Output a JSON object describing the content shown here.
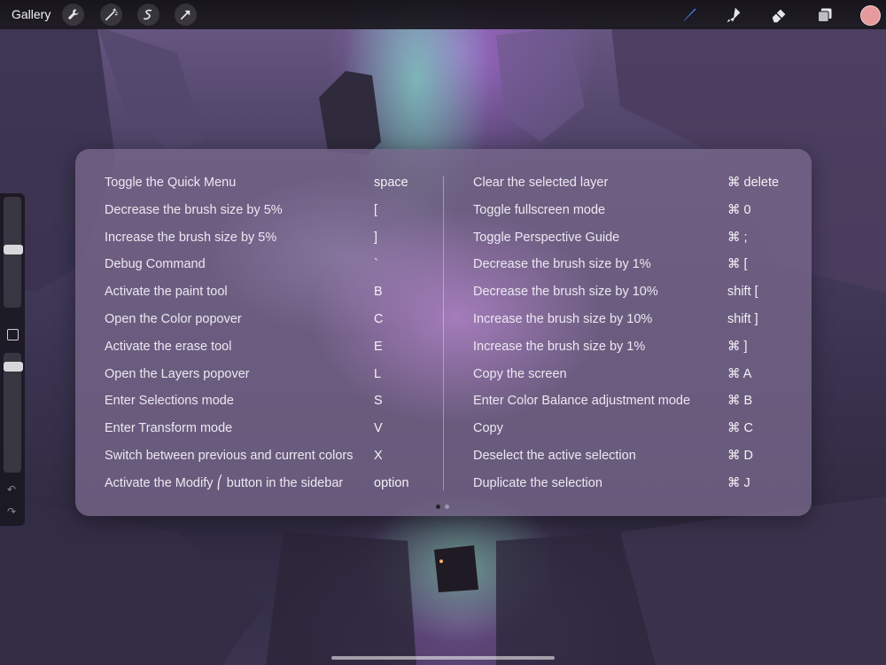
{
  "toolbar": {
    "gallery_label": "Gallery",
    "accent_color": "#4a8cff",
    "current_color": "#e59a9e",
    "left_icons": [
      "wrench-icon",
      "magic-wand-icon",
      "selection-icon",
      "transform-arrow-icon"
    ],
    "right_icons": [
      "brush-icon",
      "smudge-icon",
      "eraser-icon",
      "layers-icon",
      "color-swatch-icon"
    ]
  },
  "shortcuts": {
    "left": [
      {
        "label": "Toggle the Quick Menu",
        "key": "space"
      },
      {
        "label": "Decrease the brush size by 5%",
        "key": "["
      },
      {
        "label": "Increase the brush size by 5%",
        "key": "]"
      },
      {
        "label": "Debug Command",
        "key": "`"
      },
      {
        "label": "Activate the paint tool",
        "key": "B"
      },
      {
        "label": "Open the Color popover",
        "key": "C"
      },
      {
        "label": "Activate the erase tool",
        "key": "E"
      },
      {
        "label": "Open the Layers popover",
        "key": "L"
      },
      {
        "label": "Enter Selections mode",
        "key": "S"
      },
      {
        "label": "Enter Transform mode",
        "key": "V"
      },
      {
        "label": "Switch between previous and current colors",
        "key": "X"
      },
      {
        "label": "Activate the Modify ⎛ button in the sidebar",
        "key": "option"
      }
    ],
    "right": [
      {
        "label": "Clear the selected layer",
        "key": "⌘  delete"
      },
      {
        "label": "Toggle fullscreen mode",
        "key": "⌘  0"
      },
      {
        "label": "Toggle Perspective Guide",
        "key": "⌘  ;"
      },
      {
        "label": "Decrease the brush size by 1%",
        "key": "⌘  ["
      },
      {
        "label": "Decrease the brush size by 10%",
        "key": "shift ["
      },
      {
        "label": "Increase the brush size by 10%",
        "key": "shift ]"
      },
      {
        "label": "Increase the brush size by 1%",
        "key": "⌘  ]"
      },
      {
        "label": "Copy the screen",
        "key": "⌘  A"
      },
      {
        "label": "Enter Color Balance adjustment mode",
        "key": "⌘  B"
      },
      {
        "label": "Copy",
        "key": "⌘  C"
      },
      {
        "label": "Deselect the active selection",
        "key": "⌘  D"
      },
      {
        "label": "Duplicate the selection",
        "key": "⌘  J"
      }
    ]
  },
  "pager": {
    "pages": 2,
    "current": 1
  },
  "sidebar": {
    "brush_size_level": 0.5,
    "opacity_level": 0.88
  }
}
